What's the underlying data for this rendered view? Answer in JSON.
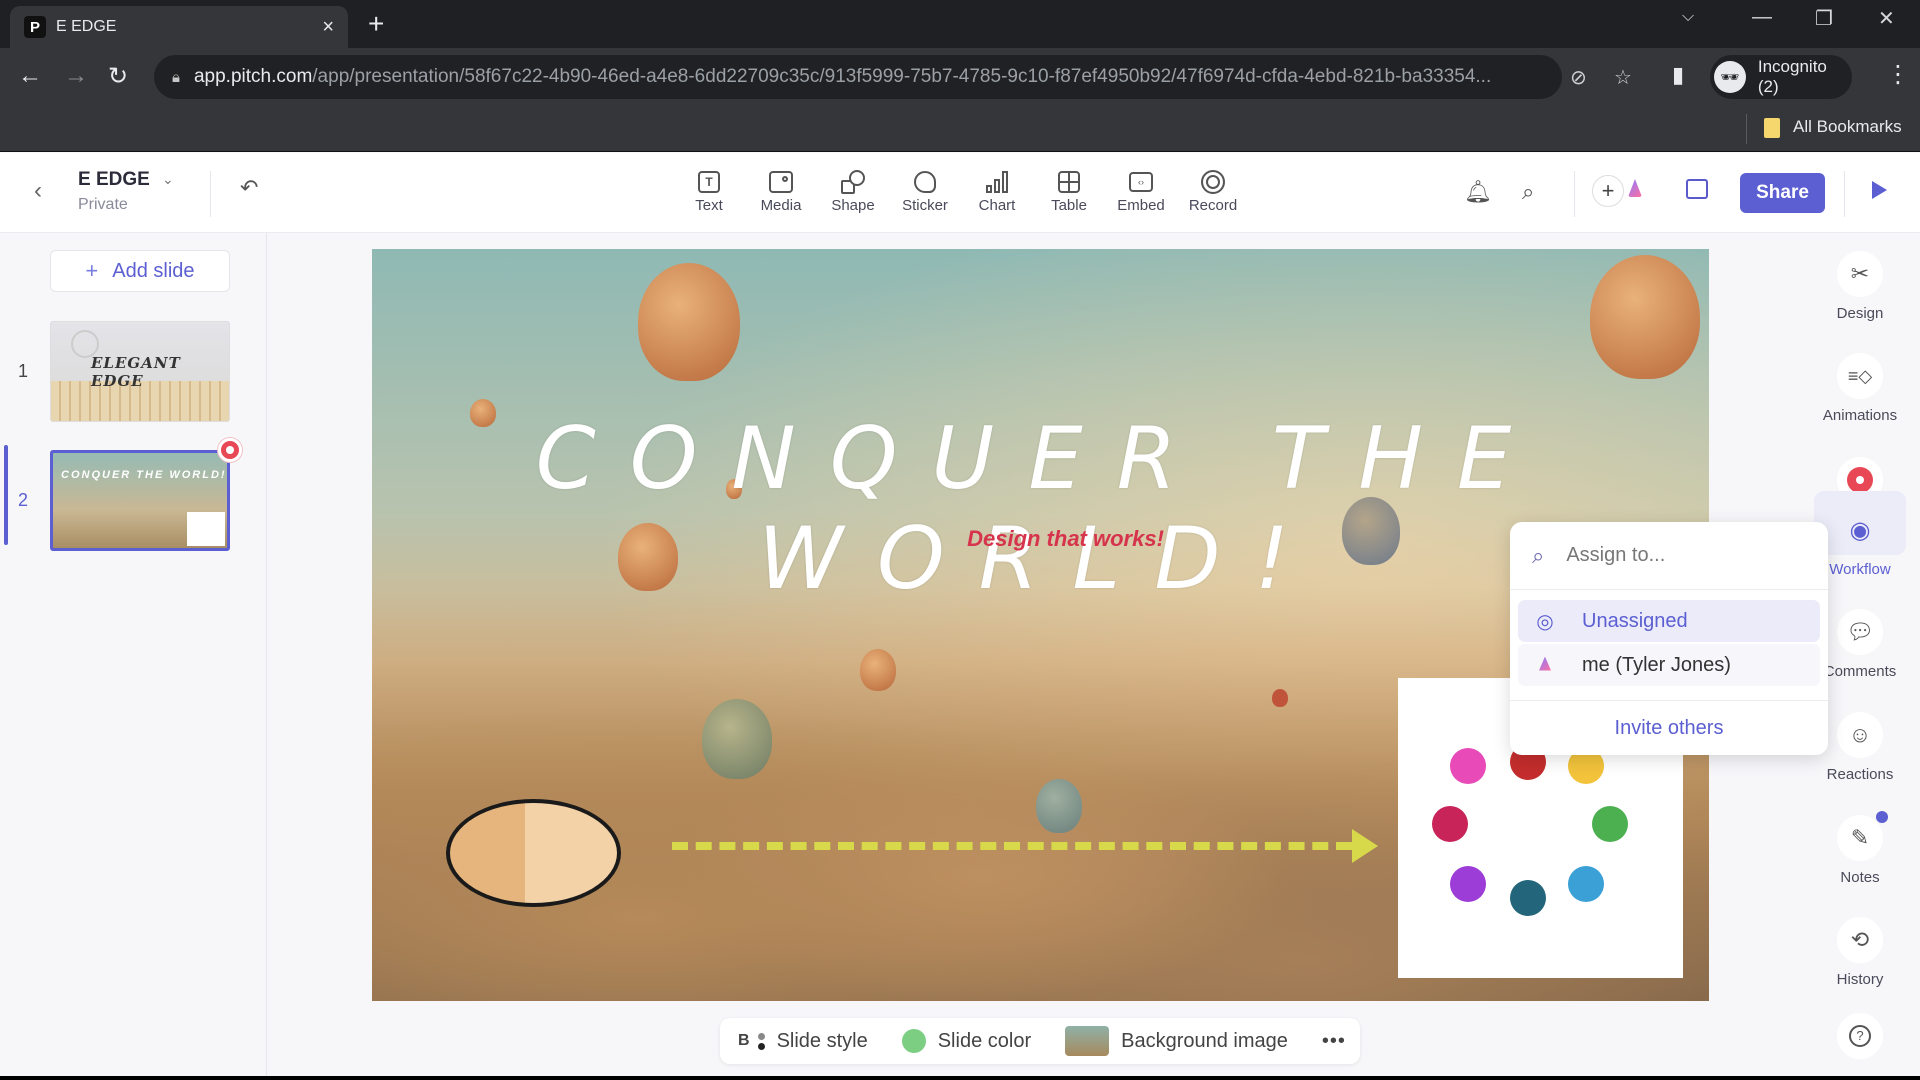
{
  "browser": {
    "tab_title": "E EDGE",
    "favicon_letter": "P",
    "url_host": "app.pitch.com",
    "url_path": "/app/presentation/58f67c22-4b90-46ed-a4e8-6dd22709c35c/913f5999-75b7-4785-9c10-f87ef4950b92/47f6974d-cfda-4ebd-821b-ba33354...",
    "profile_label": "Incognito (2)",
    "bookmarks_label": "All Bookmarks"
  },
  "doc": {
    "title": "E EDGE",
    "visibility": "Private"
  },
  "toolbar": {
    "tools": [
      {
        "label": "Text",
        "icon": "text-icon"
      },
      {
        "label": "Media",
        "icon": "media-icon"
      },
      {
        "label": "Shape",
        "icon": "shape-icon"
      },
      {
        "label": "Sticker",
        "icon": "sticker-icon"
      },
      {
        "label": "Chart",
        "icon": "chart-icon"
      },
      {
        "label": "Table",
        "icon": "table-icon"
      },
      {
        "label": "Embed",
        "icon": "embed-icon"
      },
      {
        "label": "Record",
        "icon": "record-icon"
      }
    ],
    "share_label": "Share"
  },
  "sidebar": {
    "add_slide_label": "Add slide",
    "slides": [
      {
        "number": "1",
        "title": "ELEGANT EDGE"
      },
      {
        "number": "2",
        "title": "CONQUER THE WORLD!"
      }
    ]
  },
  "slide": {
    "title": "CONQUER THE WORLD!",
    "subtitle": "Design that works!"
  },
  "assign_menu": {
    "placeholder": "Assign to...",
    "options": [
      {
        "label": "Unassigned",
        "icon": "user-circle-icon"
      },
      {
        "label": "me (Tyler Jones)",
        "icon": "user-avatar-icon"
      }
    ],
    "invite_label": "Invite others"
  },
  "right_rail": {
    "items": [
      {
        "label": "Design"
      },
      {
        "label": "Animations"
      },
      {
        "label": "Workflow"
      },
      {
        "label": "Comments"
      },
      {
        "label": "Reactions"
      },
      {
        "label": "Notes"
      },
      {
        "label": "History"
      }
    ]
  },
  "bottom_bar": {
    "style_label": "Slide style",
    "style_letter": "B",
    "color_label": "Slide color",
    "slide_color": "#7ccf82",
    "image_label": "Background image",
    "more_label": "•••"
  },
  "colors": {
    "accent": "#5b5fd1",
    "record_red": "#e84855",
    "subtitle_red": "#d6334c"
  }
}
